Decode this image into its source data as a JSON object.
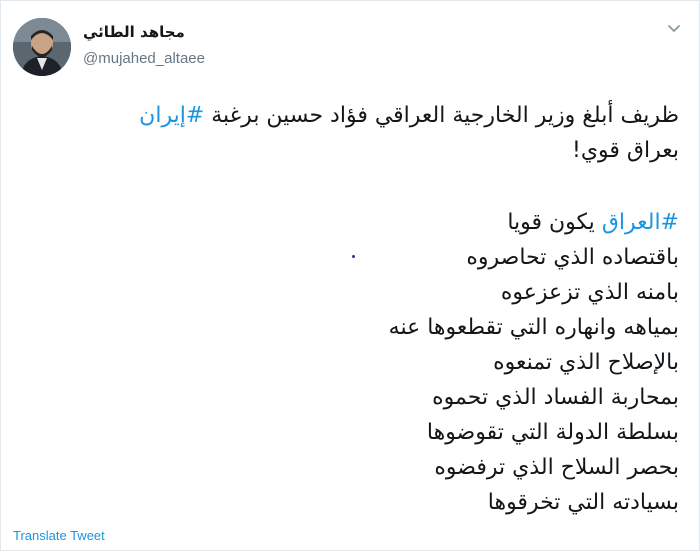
{
  "author": {
    "name": "مجاهد الطائي",
    "handle": "@mujahed_altaee"
  },
  "icons": {
    "menu": "chevron-down-icon",
    "avatar": "profile-photo"
  },
  "tweet": {
    "line1_text": "ظريف أبلغ وزير الخارجية العراقي فؤاد حسين برغبة ",
    "line1_hashtag": "#إيران",
    "line2": "بعراق قوي!",
    "line3_hashtag": "#العراق",
    "line3_text": " يكون قويا",
    "lines": [
      "باقتصاده الذي تحاصروه",
      "بامنه الذي تزعزعوه",
      "بمياهه وانهاره التي تقطعوها عنه",
      "بالإصلاح الذي تمنعوه",
      "بمحاربة الفساد الذي تحموه",
      "بسلطة الدولة التي تقوضوها",
      "بحصر السلاح الذي ترفضوه",
      "بسيادته التي تخرقوها"
    ]
  },
  "footer": {
    "translate_label": "Translate Tweet"
  },
  "colors": {
    "link": "#1b95e0",
    "text": "#14171a",
    "secondary": "#657786",
    "border": "#e1e8ed"
  }
}
